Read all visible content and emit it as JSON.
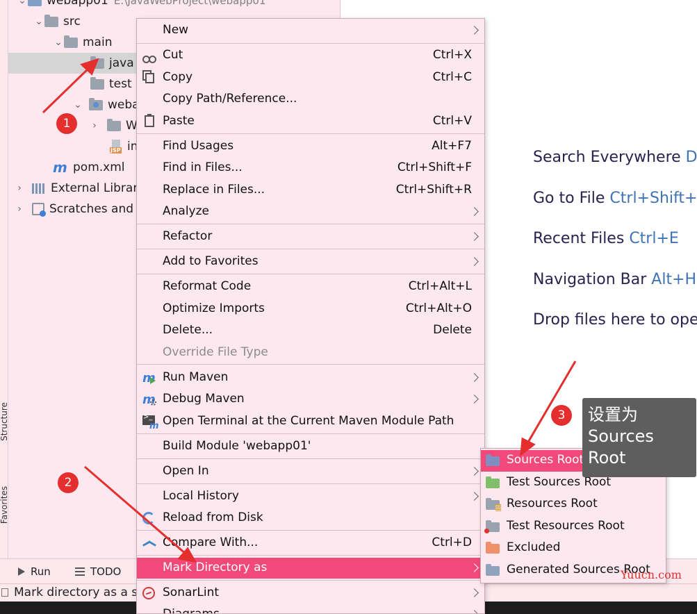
{
  "side_tabs": {
    "structure": "Structure",
    "favorites": "Favorites"
  },
  "tree": {
    "items": [
      {
        "label": "webapp01",
        "path": "E:\\JavaWebProject\\webapp01"
      },
      {
        "label": "src"
      },
      {
        "label": "main"
      },
      {
        "label": "java"
      },
      {
        "label": "test"
      },
      {
        "label": "weba"
      },
      {
        "label": "W"
      },
      {
        "label": "in"
      },
      {
        "label": "pom.xml"
      },
      {
        "label": "External Librar"
      },
      {
        "label": "Scratches and"
      }
    ]
  },
  "welcome": {
    "items": [
      {
        "label": "Search Everywhere",
        "shortcut": "Do"
      },
      {
        "label": "Go to File",
        "shortcut": "Ctrl+Shift+"
      },
      {
        "label": "Recent Files",
        "shortcut": "Ctrl+E"
      },
      {
        "label": "Navigation Bar",
        "shortcut": "Alt+H"
      },
      {
        "label": "Drop files here to ope",
        "shortcut": ""
      }
    ]
  },
  "bottom": {
    "run": "Run",
    "todo": "TODO",
    "status": "Mark directory as a so"
  },
  "menu": {
    "items": [
      {
        "label": "New",
        "shortcut": ""
      },
      {
        "label": "Cut",
        "shortcut": "Ctrl+X"
      },
      {
        "label": "Copy",
        "shortcut": "Ctrl+C"
      },
      {
        "label": "Copy Path/Reference...",
        "shortcut": ""
      },
      {
        "label": "Paste",
        "shortcut": "Ctrl+V"
      },
      {
        "label": "Find Usages",
        "shortcut": "Alt+F7"
      },
      {
        "label": "Find in Files...",
        "shortcut": "Ctrl+Shift+F"
      },
      {
        "label": "Replace in Files...",
        "shortcut": "Ctrl+Shift+R"
      },
      {
        "label": "Analyze",
        "shortcut": ""
      },
      {
        "label": "Refactor",
        "shortcut": ""
      },
      {
        "label": "Add to Favorites",
        "shortcut": ""
      },
      {
        "label": "Reformat Code",
        "shortcut": "Ctrl+Alt+L"
      },
      {
        "label": "Optimize Imports",
        "shortcut": "Ctrl+Alt+O"
      },
      {
        "label": "Delete...",
        "shortcut": "Delete"
      },
      {
        "label": "Override File Type",
        "shortcut": ""
      },
      {
        "label": "Run Maven",
        "shortcut": ""
      },
      {
        "label": "Debug Maven",
        "shortcut": ""
      },
      {
        "label": "Open Terminal at the Current Maven Module Path",
        "shortcut": ""
      },
      {
        "label": "Build Module 'webapp01'",
        "shortcut": ""
      },
      {
        "label": "Open In",
        "shortcut": ""
      },
      {
        "label": "Local History",
        "shortcut": ""
      },
      {
        "label": "Reload from Disk",
        "shortcut": ""
      },
      {
        "label": "Compare With...",
        "shortcut": "Ctrl+D"
      },
      {
        "label": "Mark Directory as",
        "shortcut": ""
      },
      {
        "label": "SonarLint",
        "shortcut": ""
      },
      {
        "label": "Diagrams",
        "shortcut": ""
      }
    ]
  },
  "submenu": {
    "items": [
      {
        "label": "Sources Root",
        "icon_color": "#7f8fbf"
      },
      {
        "label": "Test Sources Root",
        "icon_color": "#7fbf6a"
      },
      {
        "label": "Resources Root",
        "icon_color": "#9aa3ad"
      },
      {
        "label": "Test Resources Root",
        "icon_color": "#9aa3ad"
      },
      {
        "label": "Excluded",
        "icon_color": "#f0906a"
      },
      {
        "label": "Generated Sources Root",
        "icon_color": "#8fa3bd"
      }
    ]
  },
  "annotations": {
    "badges": [
      "1",
      "2",
      "3"
    ],
    "tooltip": [
      "设置为",
      "Sources",
      "Root"
    ],
    "watermark": "Yuucn.com"
  },
  "colors": {
    "menu_bg": "#fce8ee",
    "highlight": "#f2497a",
    "annotation_red": "#e52e2e",
    "shortcut_blue": "#3f73b5"
  }
}
